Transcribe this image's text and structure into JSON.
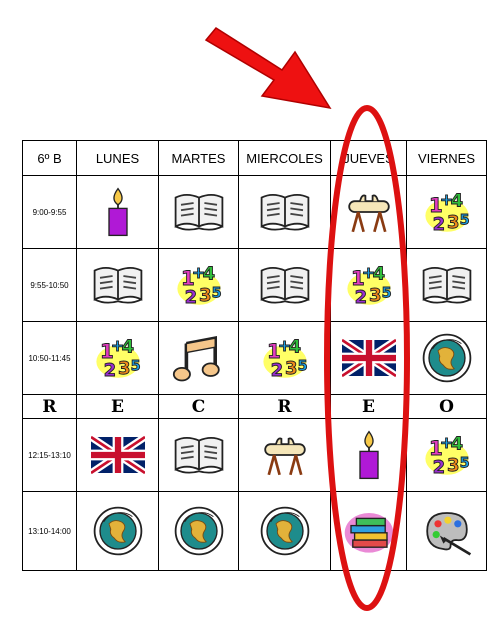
{
  "title_cell": "6º B",
  "days": [
    "LUNES",
    "MARTES",
    "MIERCOLES",
    "JUEVES",
    "VIERNES"
  ],
  "times": [
    "9:00-9:55",
    "9:55-10:50",
    "10:50-11:45",
    "12:15-13:10",
    "13:10-14:00"
  ],
  "recreo_letters": [
    "R",
    "E",
    "C",
    "R",
    "E",
    "O"
  ],
  "schedule": [
    [
      "candle-icon",
      "book-icon",
      "book-icon",
      "pommel-horse-icon",
      "numbers-icon"
    ],
    [
      "book-icon",
      "numbers-icon",
      "book-icon",
      "numbers-icon",
      "book-icon"
    ],
    [
      "numbers-icon",
      "music-note-icon",
      "numbers-icon",
      "uk-flag-icon",
      "globe-icon"
    ],
    [
      "uk-flag-icon",
      "book-icon",
      "pommel-horse-icon",
      "candle-icon",
      "numbers-icon"
    ],
    [
      "globe-icon",
      "globe-icon",
      "globe-icon",
      "books-stack-icon",
      "palette-icon"
    ]
  ],
  "colors": {
    "arrow": "#ee1111",
    "ellipse": "#dd1111"
  }
}
